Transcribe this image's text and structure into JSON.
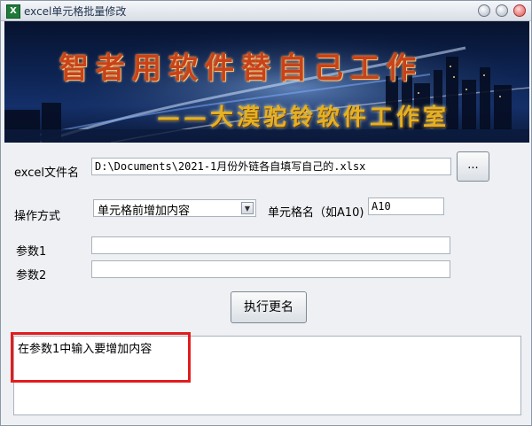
{
  "window": {
    "title": "excel单元格批量修改",
    "app_icon_glyph": "X",
    "buttons": [
      "minimize-icon",
      "maximize-icon",
      "close-icon"
    ]
  },
  "banner": {
    "headline": "智者用软件替自己工作",
    "subline": "——大漠驼铃软件工作室"
  },
  "form": {
    "file_label": "excel文件名",
    "file_value": "D:\\Documents\\2021-1月份外链各自填写自己的.xlsx",
    "browse_label": "...",
    "mode_label": "操作方式",
    "mode_value": "单元格前增加内容",
    "cell_label": "单元格名（如A10)",
    "cell_value": "A10",
    "param1_label": "参数1",
    "param1_value": "",
    "param2_label": "参数2",
    "param2_value": "",
    "run_label": "执行更名"
  },
  "output": {
    "text": "在参数1中输入要增加内容"
  },
  "colors": {
    "highlight": "#e41c1c",
    "headline": "#c8421a",
    "subline": "#e5b022"
  }
}
